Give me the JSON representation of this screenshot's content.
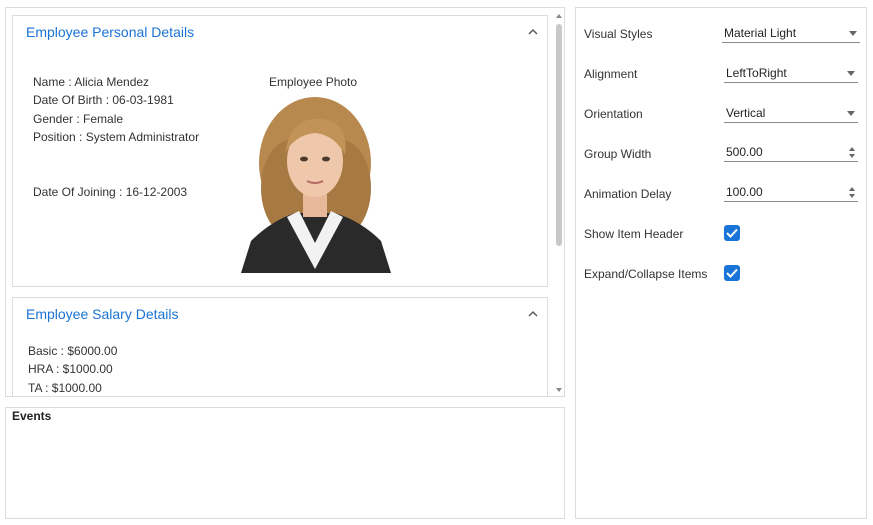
{
  "personal": {
    "title": "Employee Personal Details",
    "name": "Name : Alicia Mendez",
    "dob": "Date Of Birth : 06-03-1981",
    "gender": "Gender : Female",
    "position": "Position : System Administrator",
    "joining": "Date Of Joining : 16-12-2003",
    "photo_label": "Employee Photo"
  },
  "salary": {
    "title": "Employee Salary Details",
    "basic": "Basic : $6000.00",
    "hra": "HRA : $1000.00",
    "ta": "TA : $1000.00"
  },
  "events": {
    "title": "Events"
  },
  "properties": {
    "visual_styles": {
      "label": "Visual Styles",
      "value": "Material Light"
    },
    "alignment": {
      "label": "Alignment",
      "value": "LeftToRight"
    },
    "orientation": {
      "label": "Orientation",
      "value": "Vertical"
    },
    "group_width": {
      "label": "Group Width",
      "value": "500.00"
    },
    "animation_delay": {
      "label": "Animation Delay",
      "value": "100.00"
    },
    "show_item_header": {
      "label": "Show Item Header",
      "checked": true
    },
    "expand_collapse": {
      "label": "Expand/Collapse Items",
      "checked": true
    }
  },
  "icons": {
    "collapse": "chevron-up-icon",
    "dropdown": "caret-down-icon",
    "spin": "spin-arrows-icon",
    "check": "checkmark-icon"
  },
  "colors": {
    "accent": "#1a73d6",
    "border": "#dcdcdc",
    "text": "#333333"
  }
}
